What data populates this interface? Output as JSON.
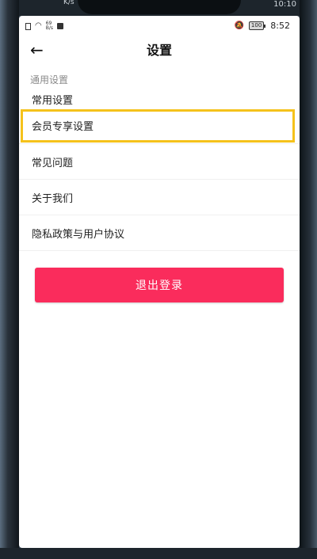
{
  "corner": {
    "time_fragment": "10:10",
    "speed_fragment": "K/s"
  },
  "status_bar": {
    "net_speed_value": "69",
    "net_speed_unit": "B/s",
    "battery": "100",
    "time": "8:52"
  },
  "header": {
    "title": "设置"
  },
  "section": {
    "label": "通用设置"
  },
  "settings_items": [
    {
      "label": "常用设置"
    },
    {
      "label": "会员专享设置"
    },
    {
      "label": "常见问题"
    },
    {
      "label": "关于我们"
    },
    {
      "label": "隐私政策与用户协议"
    }
  ],
  "logout": {
    "label": "退出登录"
  },
  "colors": {
    "accent": "#fa2c5c",
    "highlight": "#f5c21b"
  }
}
